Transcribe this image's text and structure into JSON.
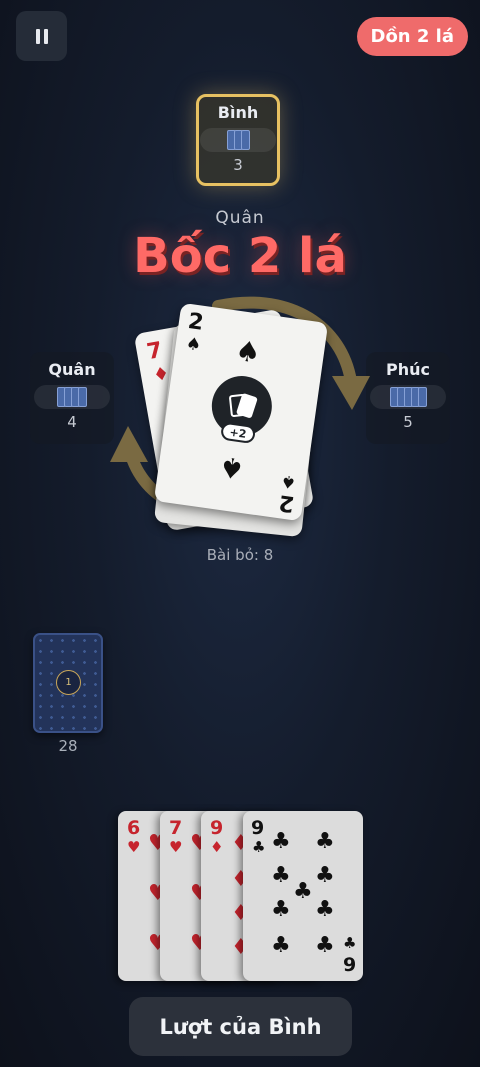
{
  "controls": {
    "pause_icon": "pause-icon"
  },
  "stack_badge": "Dồn 2 lá",
  "opponents": {
    "top": {
      "name": "Bình",
      "count": "3"
    },
    "left": {
      "name": "Quân",
      "count": "4"
    },
    "right": {
      "name": "Phúc",
      "count": "5"
    }
  },
  "last_action": {
    "actor": "Quân",
    "text": "Bốc 2 lá"
  },
  "discard": {
    "top_card": {
      "rank": "2",
      "suit": "♠",
      "badge": "+2",
      "icon": "draw-cards-icon"
    },
    "under_card": {
      "rank": "7",
      "suit": "♦"
    },
    "label": "Bài bỏ: 8"
  },
  "draw_pile": {
    "count": "28",
    "emblem": "1"
  },
  "hand": [
    {
      "rank": "6",
      "suit": "♥",
      "color": "#c6242d"
    },
    {
      "rank": "7",
      "suit": "♥",
      "color": "#c6242d"
    },
    {
      "rank": "9",
      "suit": "♦",
      "color": "#c6242d"
    },
    {
      "rank": "9",
      "suit": "♣",
      "color": "#111111"
    }
  ],
  "turn_button": "Lượt của Bình",
  "colors": {
    "accent_red": "#ef6b6b",
    "active_gold": "#e7c162",
    "arrow_gold": "#7a6a42"
  }
}
